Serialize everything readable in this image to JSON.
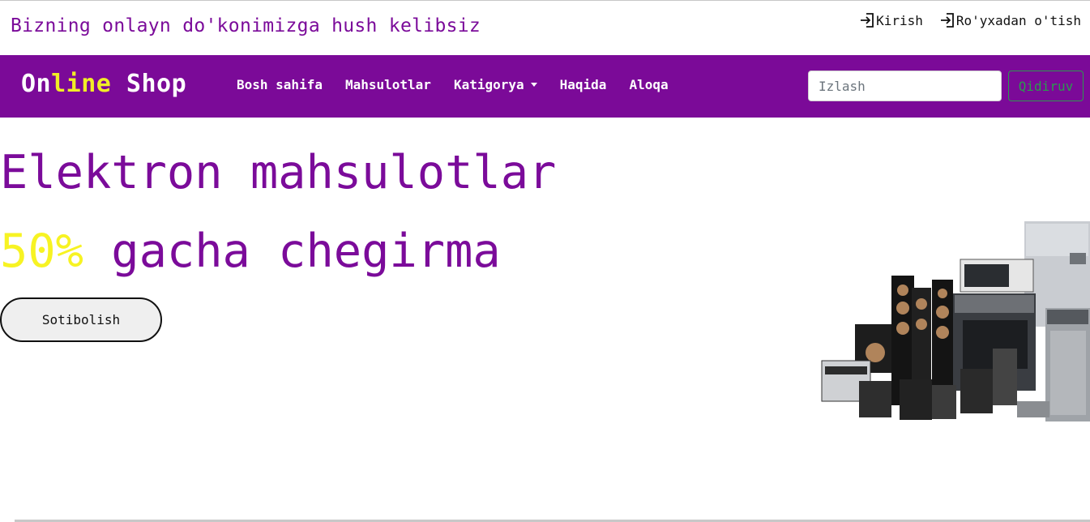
{
  "header": {
    "welcome_text": "Bizning onlayn do'konimizga hush kelibsiz",
    "auth_links": [
      {
        "icon": "login-arrow-icon",
        "label": "Kirish"
      },
      {
        "icon": "login-arrow-icon",
        "label": "Ro'yxadan o'tish"
      }
    ]
  },
  "navbar": {
    "brand_part1": "On",
    "brand_highlight": "line",
    "brand_part2": " Shop",
    "items": [
      {
        "label": "Bosh sahifa"
      },
      {
        "label": "Mahsulotlar"
      },
      {
        "label": "Katigorya",
        "has_dropdown": true
      },
      {
        "label": "Haqida"
      },
      {
        "label": "Aloqa"
      }
    ],
    "search": {
      "placeholder": "Izlash",
      "button_label": "Qidiruv"
    }
  },
  "hero": {
    "title": "Elektron mahsulotlar",
    "discount_value": "50%",
    "discount_text": " gacha chegirma",
    "cta_label": "Sotibolish"
  },
  "colors": {
    "brand_purple": "#7b0a98",
    "highlight_yellow": "#f1ee26",
    "search_button_green": "#2b9a4e"
  }
}
